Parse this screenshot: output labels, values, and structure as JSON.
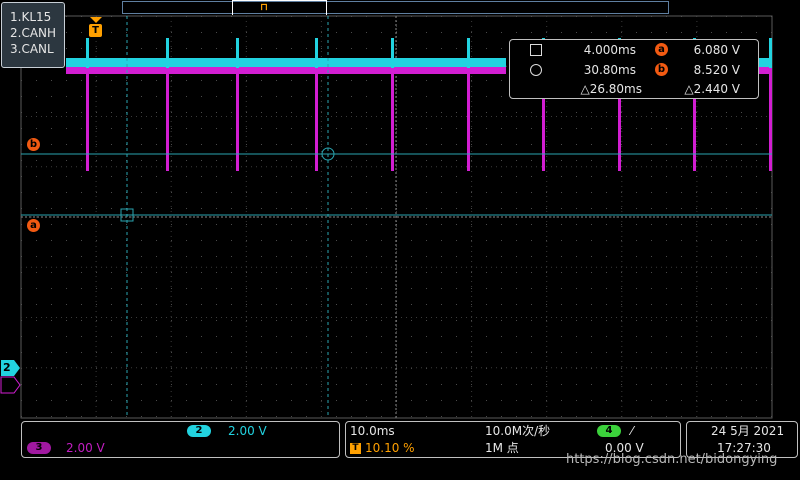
{
  "legend": {
    "items": [
      "1.KL15",
      "2.CANH",
      "3.CANL"
    ]
  },
  "markers": {
    "trigger": "T",
    "cursor_a": "a",
    "cursor_b": "b",
    "ch2_ground": "2"
  },
  "cursor_readout": {
    "a_time": "4.000ms",
    "a_value": "6.080 V",
    "b_time": "30.80ms",
    "b_value": "8.520 V",
    "delta_time": "△26.80ms",
    "delta_value": "△2.440 V",
    "badge_a": "a",
    "badge_b": "b"
  },
  "channels": {
    "ch2_label": "2",
    "ch2_scale": "2.00 V",
    "ch3_label": "3",
    "ch3_scale": "2.00 V"
  },
  "horizontal": {
    "timebase": "10.0ms",
    "trigger_icon": "T",
    "trigger_pos": "10.10 %",
    "sample_rate": "10.0M次/秒",
    "record_length": "1M 点",
    "trig_source": "4",
    "trig_slope": "⁄",
    "trig_level": "0.00 V"
  },
  "datetime": {
    "date": "24 5月 2021",
    "time": "17:27:30"
  },
  "watermark": "https://blog.csdn.net/bidongying",
  "colors": {
    "ch2": "#22d3e0",
    "ch3": "#d21ed2",
    "cursor": "#f25a12",
    "grid": "#6f6f6f",
    "ch4": "#3bd13b"
  }
}
